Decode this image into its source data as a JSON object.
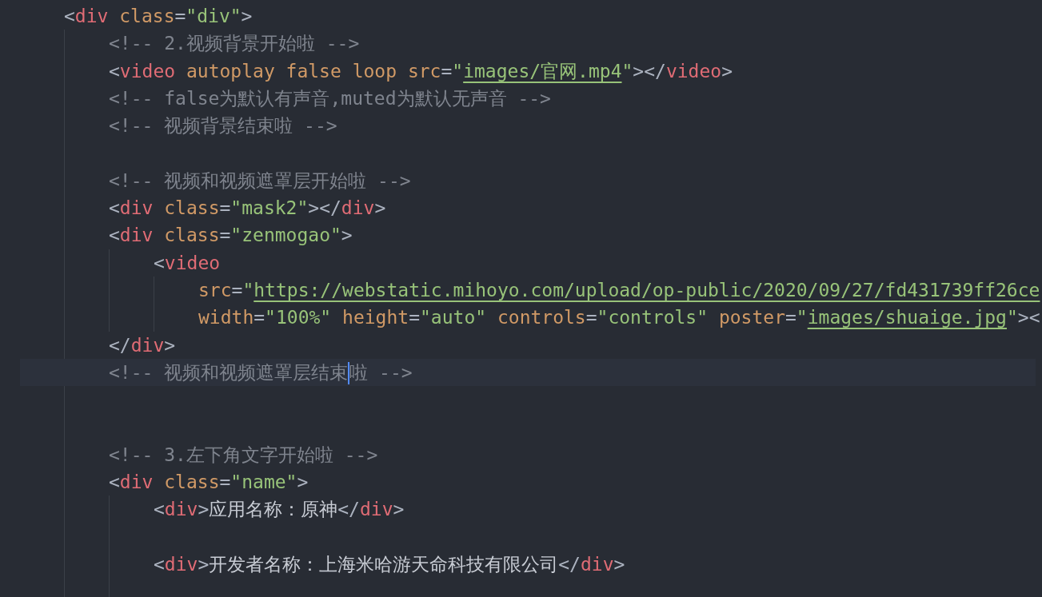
{
  "lines": [
    {
      "kind": "code",
      "tokens": [
        {
          "kind": "punct",
          "text": "<"
        },
        {
          "kind": "tag",
          "text": "div"
        },
        {
          "kind": "attr",
          "text": " class"
        },
        {
          "kind": "punct",
          "text": "="
        },
        {
          "kind": "string",
          "text": "\"div\""
        },
        {
          "kind": "punct",
          "text": ">"
        }
      ],
      "children": [
        {
          "kind": "code",
          "tokens": [
            {
              "kind": "comment",
              "text": "<!-- 2.视频背景开始啦 -->"
            }
          ]
        },
        {
          "kind": "code",
          "tokens": [
            {
              "kind": "punct",
              "text": "<"
            },
            {
              "kind": "tag",
              "text": "video"
            },
            {
              "kind": "attr",
              "text": " autoplay false loop src"
            },
            {
              "kind": "punct",
              "text": "="
            },
            {
              "kind": "string",
              "text": "\""
            },
            {
              "kind": "link",
              "text": "images/官网.mp4"
            },
            {
              "kind": "string",
              "text": "\""
            },
            {
              "kind": "punct",
              "text": "></"
            },
            {
              "kind": "tag",
              "text": "video"
            },
            {
              "kind": "punct",
              "text": ">"
            }
          ]
        },
        {
          "kind": "code",
          "tokens": [
            {
              "kind": "comment",
              "text": "<!-- false为默认有声音,muted为默认无声音 -->"
            }
          ]
        },
        {
          "kind": "code",
          "tokens": [
            {
              "kind": "comment",
              "text": "<!-- 视频背景结束啦 -->"
            }
          ]
        },
        {
          "kind": "blank"
        },
        {
          "kind": "code",
          "tokens": [
            {
              "kind": "comment",
              "text": "<!-- 视频和视频遮罩层开始啦 -->"
            }
          ]
        },
        {
          "kind": "code",
          "tokens": [
            {
              "kind": "punct",
              "text": "<"
            },
            {
              "kind": "tag",
              "text": "div"
            },
            {
              "kind": "attr",
              "text": " class"
            },
            {
              "kind": "punct",
              "text": "="
            },
            {
              "kind": "string",
              "text": "\"mask2\""
            },
            {
              "kind": "punct",
              "text": "></"
            },
            {
              "kind": "tag",
              "text": "div"
            },
            {
              "kind": "punct",
              "text": ">"
            }
          ]
        },
        {
          "kind": "code",
          "tokens": [
            {
              "kind": "punct",
              "text": "<"
            },
            {
              "kind": "tag",
              "text": "div"
            },
            {
              "kind": "attr",
              "text": " class"
            },
            {
              "kind": "punct",
              "text": "="
            },
            {
              "kind": "string",
              "text": "\"zenmogao\""
            },
            {
              "kind": "punct",
              "text": ">"
            }
          ],
          "children": [
            {
              "kind": "code",
              "tokens": [
                {
                  "kind": "punct",
                  "text": "<"
                },
                {
                  "kind": "tag",
                  "text": "video"
                }
              ],
              "children": [
                {
                  "kind": "code",
                  "tokens": [
                    {
                      "kind": "attr",
                      "text": "src"
                    },
                    {
                      "kind": "punct",
                      "text": "="
                    },
                    {
                      "kind": "string",
                      "text": "\""
                    },
                    {
                      "kind": "link",
                      "text": "https://webstatic.mihoyo.com/upload/op-public/2020/09/27/fd431739ff26ce"
                    }
                  ]
                },
                {
                  "kind": "code",
                  "tokens": [
                    {
                      "kind": "attr",
                      "text": "width"
                    },
                    {
                      "kind": "punct",
                      "text": "="
                    },
                    {
                      "kind": "string",
                      "text": "\"100%\""
                    },
                    {
                      "kind": "attr",
                      "text": " height"
                    },
                    {
                      "kind": "punct",
                      "text": "="
                    },
                    {
                      "kind": "string",
                      "text": "\"auto\""
                    },
                    {
                      "kind": "attr",
                      "text": " controls"
                    },
                    {
                      "kind": "punct",
                      "text": "="
                    },
                    {
                      "kind": "string",
                      "text": "\"controls\""
                    },
                    {
                      "kind": "attr",
                      "text": " poster"
                    },
                    {
                      "kind": "punct",
                      "text": "="
                    },
                    {
                      "kind": "string",
                      "text": "\""
                    },
                    {
                      "kind": "link",
                      "text": "images/shuaige.jpg"
                    },
                    {
                      "kind": "string",
                      "text": "\""
                    },
                    {
                      "kind": "punct",
                      "text": "><"
                    }
                  ]
                }
              ]
            }
          ]
        },
        {
          "kind": "code",
          "tokens": [
            {
              "kind": "punct",
              "text": "</"
            },
            {
              "kind": "tag",
              "text": "div"
            },
            {
              "kind": "punct",
              "text": ">"
            }
          ]
        },
        {
          "kind": "code",
          "current": true,
          "tokens": [
            {
              "kind": "comment",
              "text": "<!-- 视频和视频遮罩层结束"
            },
            {
              "kind": "caret"
            },
            {
              "kind": "comment",
              "text": "啦 -->"
            }
          ]
        },
        {
          "kind": "blank"
        },
        {
          "kind": "blank"
        },
        {
          "kind": "code",
          "tokens": [
            {
              "kind": "comment",
              "text": "<!-- 3.左下角文字开始啦 -->"
            }
          ]
        },
        {
          "kind": "code",
          "tokens": [
            {
              "kind": "punct",
              "text": "<"
            },
            {
              "kind": "tag",
              "text": "div"
            },
            {
              "kind": "attr",
              "text": " class"
            },
            {
              "kind": "punct",
              "text": "="
            },
            {
              "kind": "string",
              "text": "\"name\""
            },
            {
              "kind": "punct",
              "text": ">"
            }
          ],
          "children": [
            {
              "kind": "code",
              "tokens": [
                {
                  "kind": "punct",
                  "text": "<"
                },
                {
                  "kind": "tag",
                  "text": "div"
                },
                {
                  "kind": "punct",
                  "text": ">"
                },
                {
                  "kind": "text",
                  "text": "应用名称：原神"
                },
                {
                  "kind": "punct",
                  "text": "</"
                },
                {
                  "kind": "tag",
                  "text": "div"
                },
                {
                  "kind": "punct",
                  "text": ">"
                }
              ]
            },
            {
              "kind": "blank"
            },
            {
              "kind": "code",
              "tokens": [
                {
                  "kind": "punct",
                  "text": "<"
                },
                {
                  "kind": "tag",
                  "text": "div"
                },
                {
                  "kind": "punct",
                  "text": ">"
                },
                {
                  "kind": "text",
                  "text": "开发者名称：上海米哈游天命科技有限公司"
                },
                {
                  "kind": "punct",
                  "text": "</"
                },
                {
                  "kind": "tag",
                  "text": "div"
                },
                {
                  "kind": "punct",
                  "text": ">"
                }
              ]
            },
            {
              "kind": "blank"
            }
          ]
        }
      ]
    }
  ]
}
